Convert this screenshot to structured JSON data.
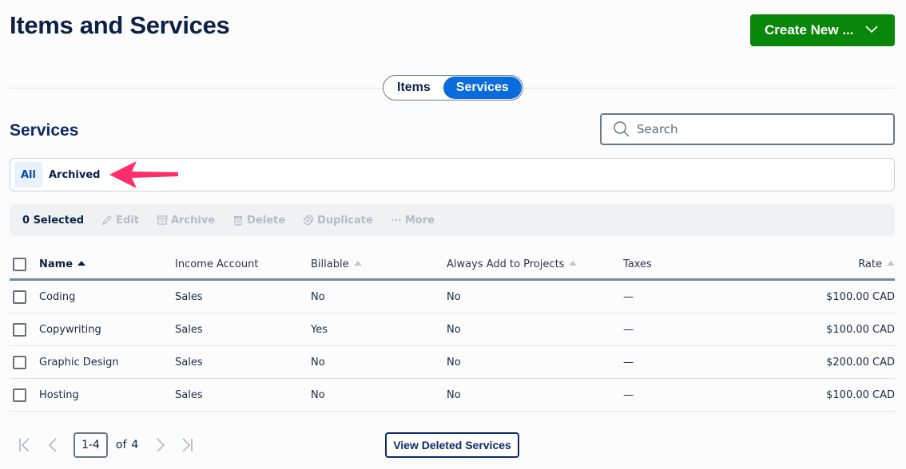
{
  "header": {
    "title": "Items and Services",
    "create_button": "Create New ...",
    "brand_color": "#09870b"
  },
  "toggle": {
    "options": [
      {
        "label": "Items",
        "active": false
      },
      {
        "label": "Services",
        "active": true
      }
    ],
    "active_color": "#0a6bdc"
  },
  "section": {
    "title": "Services"
  },
  "search": {
    "placeholder": "Search",
    "value": ""
  },
  "filters": [
    {
      "label": "All",
      "active": true
    },
    {
      "label": "Archived",
      "active": false
    }
  ],
  "annotation": {
    "type": "arrow",
    "color": "#ff2d6b",
    "points_to": "Archived"
  },
  "bulk_actions": {
    "selected": "0 Selected",
    "actions": [
      {
        "label": "Edit",
        "icon": "pencil-icon"
      },
      {
        "label": "Archive",
        "icon": "archive-box-icon"
      },
      {
        "label": "Delete",
        "icon": "trash-icon"
      },
      {
        "label": "Duplicate",
        "icon": "duplicate-icon"
      },
      {
        "label": "More",
        "icon": "ellipsis-icon"
      }
    ]
  },
  "table": {
    "columns": [
      {
        "label": "Name",
        "sortable": true,
        "sorted": true
      },
      {
        "label": "Income Account",
        "sortable": false
      },
      {
        "label": "Billable",
        "sortable": true,
        "sorted": false
      },
      {
        "label": "Always Add to Projects",
        "sortable": true,
        "sorted": false
      },
      {
        "label": "Taxes",
        "sortable": false
      },
      {
        "label": "Rate",
        "sortable": true,
        "sorted": false
      }
    ],
    "rows": [
      {
        "name": "Coding",
        "account": "Sales",
        "billable": "No",
        "projects": "No",
        "taxes": "—",
        "rate": "$100.00 CAD"
      },
      {
        "name": "Copywriting",
        "account": "Sales",
        "billable": "Yes",
        "projects": "No",
        "taxes": "—",
        "rate": "$100.00 CAD"
      },
      {
        "name": "Graphic Design",
        "account": "Sales",
        "billable": "No",
        "projects": "No",
        "taxes": "—",
        "rate": "$200.00 CAD"
      },
      {
        "name": "Hosting",
        "account": "Sales",
        "billable": "No",
        "projects": "No",
        "taxes": "—",
        "rate": "$100.00 CAD"
      }
    ]
  },
  "pagination": {
    "range": "1-4",
    "of_label": "of",
    "total": "4"
  },
  "footer": {
    "view_deleted": "View Deleted Services"
  }
}
